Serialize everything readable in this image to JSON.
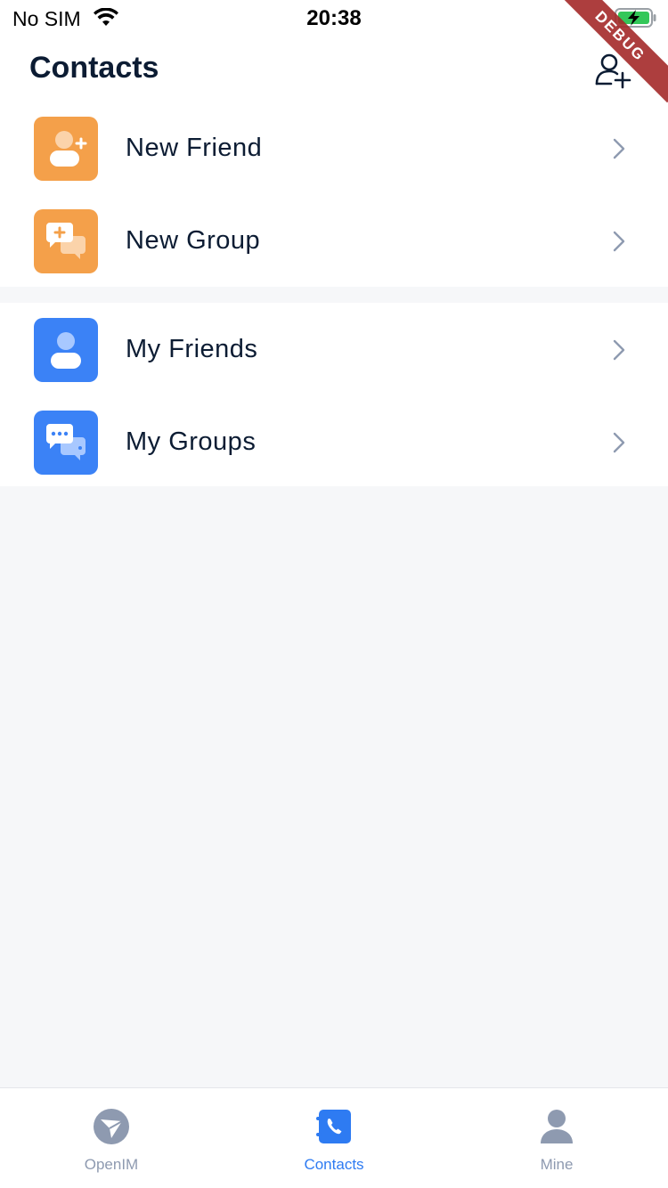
{
  "status_bar": {
    "carrier": "No SIM",
    "time": "20:38"
  },
  "debug_badge": "DEBUG",
  "header": {
    "title": "Contacts"
  },
  "sections": [
    {
      "items": [
        {
          "label": "New Friend"
        },
        {
          "label": "New Group"
        }
      ]
    },
    {
      "items": [
        {
          "label": "My Friends"
        },
        {
          "label": "My Groups"
        }
      ]
    }
  ],
  "bottom_nav": {
    "items": [
      {
        "label": "OpenIM",
        "icon": "openim-icon",
        "active": false
      },
      {
        "label": "Contacts",
        "icon": "contacts-icon",
        "active": true
      },
      {
        "label": "Mine",
        "icon": "mine-icon",
        "active": false
      }
    ]
  },
  "colors": {
    "orange": "#f4a04a",
    "blue": "#3b82f6",
    "active": "#2e7bf2",
    "inactive": "#8e9ab0"
  }
}
